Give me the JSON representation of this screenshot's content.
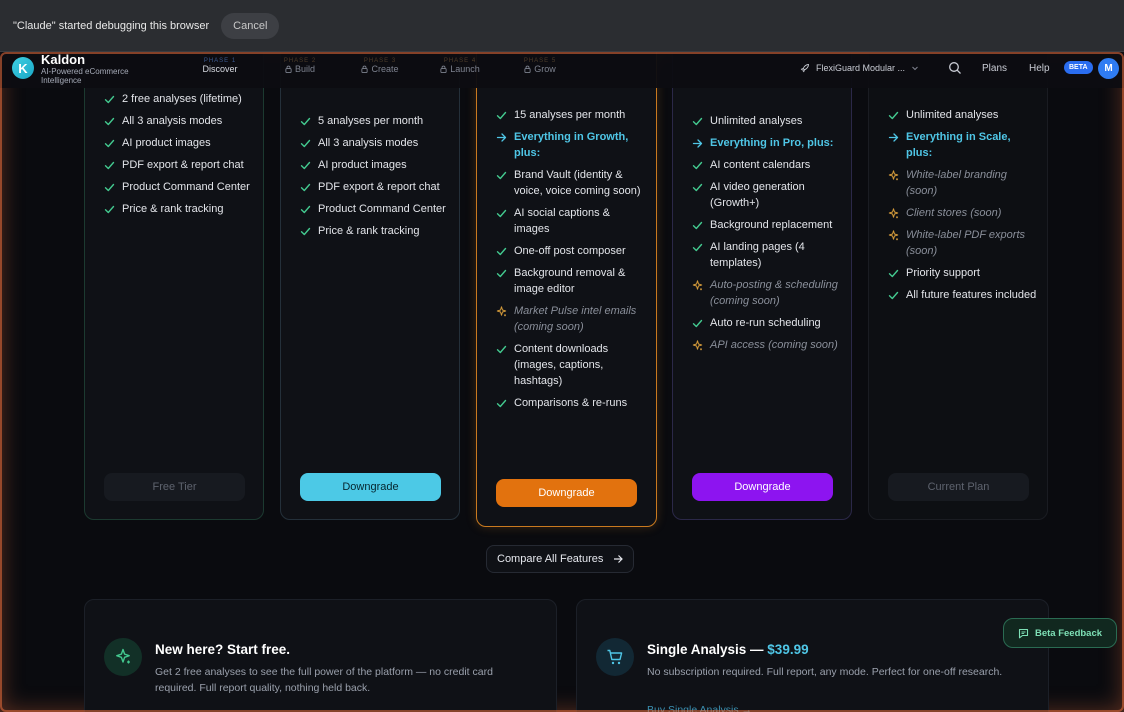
{
  "debug_bar": {
    "message": "\"Claude\" started debugging this browser",
    "cancel_label": "Cancel"
  },
  "header": {
    "brand": "Kaldon",
    "tagline": "AI-Powered eCommerce Intelligence",
    "logo_letter": "K",
    "phases": [
      {
        "num": "PHASE 1",
        "label": "Discover",
        "locked": false
      },
      {
        "num": "PHASE 2",
        "label": "Build",
        "locked": true
      },
      {
        "num": "PHASE 3",
        "label": "Create",
        "locked": true
      },
      {
        "num": "PHASE 4",
        "label": "Launch",
        "locked": true
      },
      {
        "num": "PHASE 5",
        "label": "Grow",
        "locked": true
      }
    ],
    "project": "FlexiGuard Modular ...",
    "plans": "Plans",
    "help": "Help",
    "beta": "BETA",
    "avatar": "M"
  },
  "plans": {
    "free": {
      "features": [
        {
          "text": "2 free analyses (lifetime)",
          "kind": "check"
        },
        {
          "text": "All 3 analysis modes",
          "kind": "check"
        },
        {
          "text": "AI product images",
          "kind": "check"
        },
        {
          "text": "PDF export & report chat",
          "kind": "check"
        },
        {
          "text": "Product Command Center",
          "kind": "check"
        },
        {
          "text": "Price & rank tracking",
          "kind": "check"
        }
      ],
      "button": "Free Tier"
    },
    "growth": {
      "features": [
        {
          "text": "5 analyses per month",
          "kind": "check"
        },
        {
          "text": "All 3 analysis modes",
          "kind": "check"
        },
        {
          "text": "AI product images",
          "kind": "check"
        },
        {
          "text": "PDF export & report chat",
          "kind": "check"
        },
        {
          "text": "Product Command Center",
          "kind": "check"
        },
        {
          "text": "Price & rank tracking",
          "kind": "check"
        }
      ],
      "button": "Downgrade"
    },
    "pro": {
      "features": [
        {
          "text": "15 analyses per month",
          "kind": "check"
        },
        {
          "text": "Everything in Growth, plus:",
          "kind": "plus"
        },
        {
          "text": "Brand Vault (identity & voice, voice coming soon)",
          "kind": "check"
        },
        {
          "text": "AI social captions & images",
          "kind": "check"
        },
        {
          "text": "One-off post composer",
          "kind": "check"
        },
        {
          "text": "Background removal & image editor",
          "kind": "check"
        },
        {
          "text": "Market Pulse intel emails (coming soon)",
          "kind": "soon"
        },
        {
          "text": "Content downloads (images, captions, hashtags)",
          "kind": "check"
        },
        {
          "text": "Comparisons & re-runs",
          "kind": "check"
        }
      ],
      "button": "Downgrade"
    },
    "scale": {
      "features": [
        {
          "text": "Unlimited analyses",
          "kind": "check"
        },
        {
          "text": "Everything in Pro, plus:",
          "kind": "plus"
        },
        {
          "text": "AI content calendars",
          "kind": "check"
        },
        {
          "text": "AI video generation (Growth+)",
          "kind": "check"
        },
        {
          "text": "Background replacement",
          "kind": "check"
        },
        {
          "text": "AI landing pages (4 templates)",
          "kind": "check"
        },
        {
          "text": "Auto-posting & scheduling (coming soon)",
          "kind": "soon"
        },
        {
          "text": "Auto re-run scheduling",
          "kind": "check"
        },
        {
          "text": "API access (coming soon)",
          "kind": "soon"
        }
      ],
      "button": "Downgrade"
    },
    "agency": {
      "features": [
        {
          "text": "Unlimited analyses",
          "kind": "check"
        },
        {
          "text": "Everything in Scale, plus:",
          "kind": "plus"
        },
        {
          "text": "White-label branding (soon)",
          "kind": "soon"
        },
        {
          "text": "Client stores (soon)",
          "kind": "soon"
        },
        {
          "text": "White-label PDF exports (soon)",
          "kind": "soon"
        },
        {
          "text": "Priority support",
          "kind": "check"
        },
        {
          "text": "All future features included",
          "kind": "check"
        }
      ],
      "button": "Current Plan"
    }
  },
  "compare": {
    "label": "Compare All Features"
  },
  "promo_free": {
    "title": "New here? Start free.",
    "desc": "Get 2 free analyses to see the full power of the platform — no credit card required. Full report quality, nothing held back."
  },
  "promo_single": {
    "title": "Single Analysis — ",
    "price": "$39.99",
    "desc": "No subscription required. Full report, any mode. Perfect for one-off research.",
    "link": "Buy Single Analysis →"
  },
  "feedback": {
    "label": "Beta Feedback"
  },
  "colors": {
    "accent_cyan": "#4cc9e6",
    "accent_orange": "#e2720e",
    "accent_purple": "#8d14f0",
    "check_green": "#43c98f",
    "soon_gold": "#d39a3a"
  }
}
